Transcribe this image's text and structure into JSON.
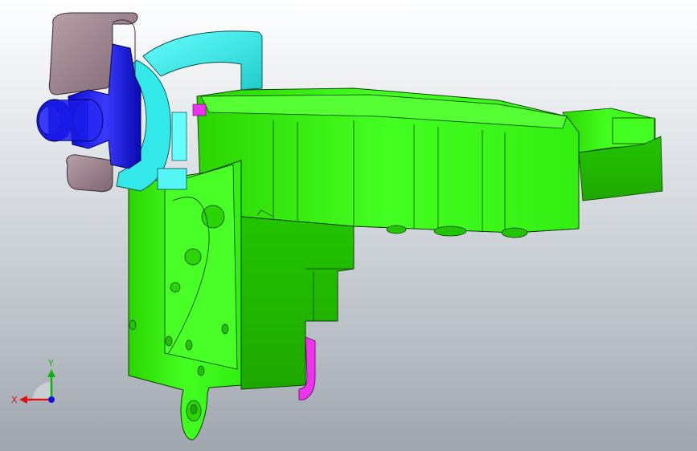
{
  "viewport": {
    "background_top": "#ffffff",
    "background_bottom": "#9ea5ad"
  },
  "model": {
    "parts": [
      {
        "name": "main-housing",
        "color": "#33ee00"
      },
      {
        "name": "mounting-bracket",
        "color": "#4dff4d"
      },
      {
        "name": "cyan-bracket",
        "color": "#33e8e8"
      },
      {
        "name": "blue-connector",
        "color": "#1a1aee"
      },
      {
        "name": "mauve-clip",
        "color": "#a08890"
      },
      {
        "name": "magenta-insert",
        "color": "#ee33ee"
      }
    ]
  },
  "triad": {
    "x_label": "X",
    "y_label": "Y",
    "x_color": "#e01010",
    "y_color": "#10b010",
    "z_color": "#1010e0"
  }
}
